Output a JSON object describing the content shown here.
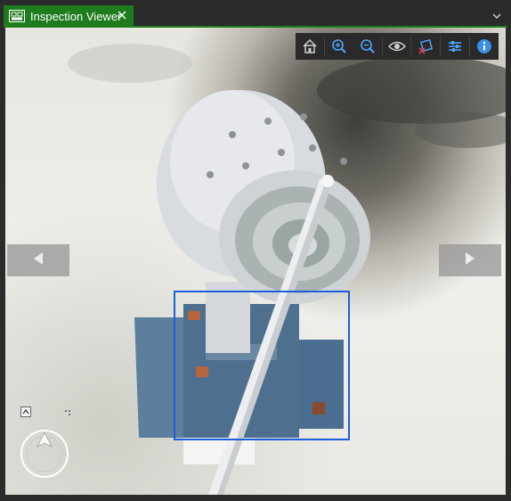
{
  "window": {
    "tab_title": "Inspection Viewer"
  },
  "icons": {
    "tab_icon": "viewer-icon",
    "tab_close": "close-icon",
    "menu": "chevron-down-icon",
    "toolbar": [
      "home-icon",
      "zoom-in-icon",
      "zoom-out-icon",
      "eye-icon",
      "clear-selection-icon",
      "adjust-icon",
      "info-icon"
    ],
    "prev": "arrow-left-icon",
    "next": "arrow-right-icon",
    "compass": "compass-icon"
  },
  "colors": {
    "tab_accent": "#1e7b1e",
    "selection_box": "#1a5fdc",
    "toolbar_icon": "#4da6ff"
  }
}
